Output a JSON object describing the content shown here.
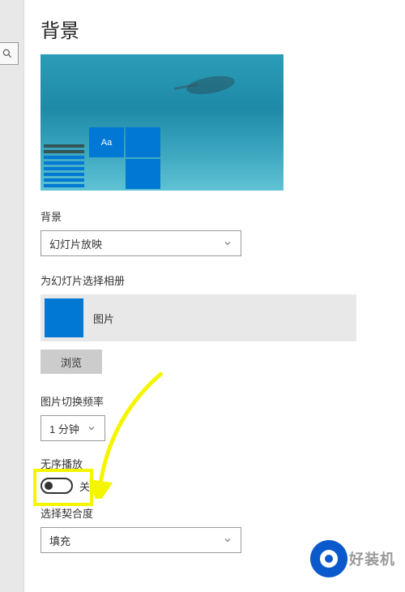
{
  "page": {
    "title": "背景"
  },
  "background": {
    "label": "背景",
    "selected": "幻灯片放映"
  },
  "album": {
    "label": "为幻灯片选择相册",
    "folder_name": "图片"
  },
  "browse": {
    "label": "浏览"
  },
  "interval": {
    "label": "图片切换频率",
    "selected": "1 分钟"
  },
  "shuffle": {
    "label": "无序播放",
    "state_label": "关"
  },
  "fit": {
    "label": "选择契合度",
    "selected": "填充"
  },
  "preview": {
    "tile_text": "Aa"
  },
  "watermark": {
    "text": "好装机"
  }
}
